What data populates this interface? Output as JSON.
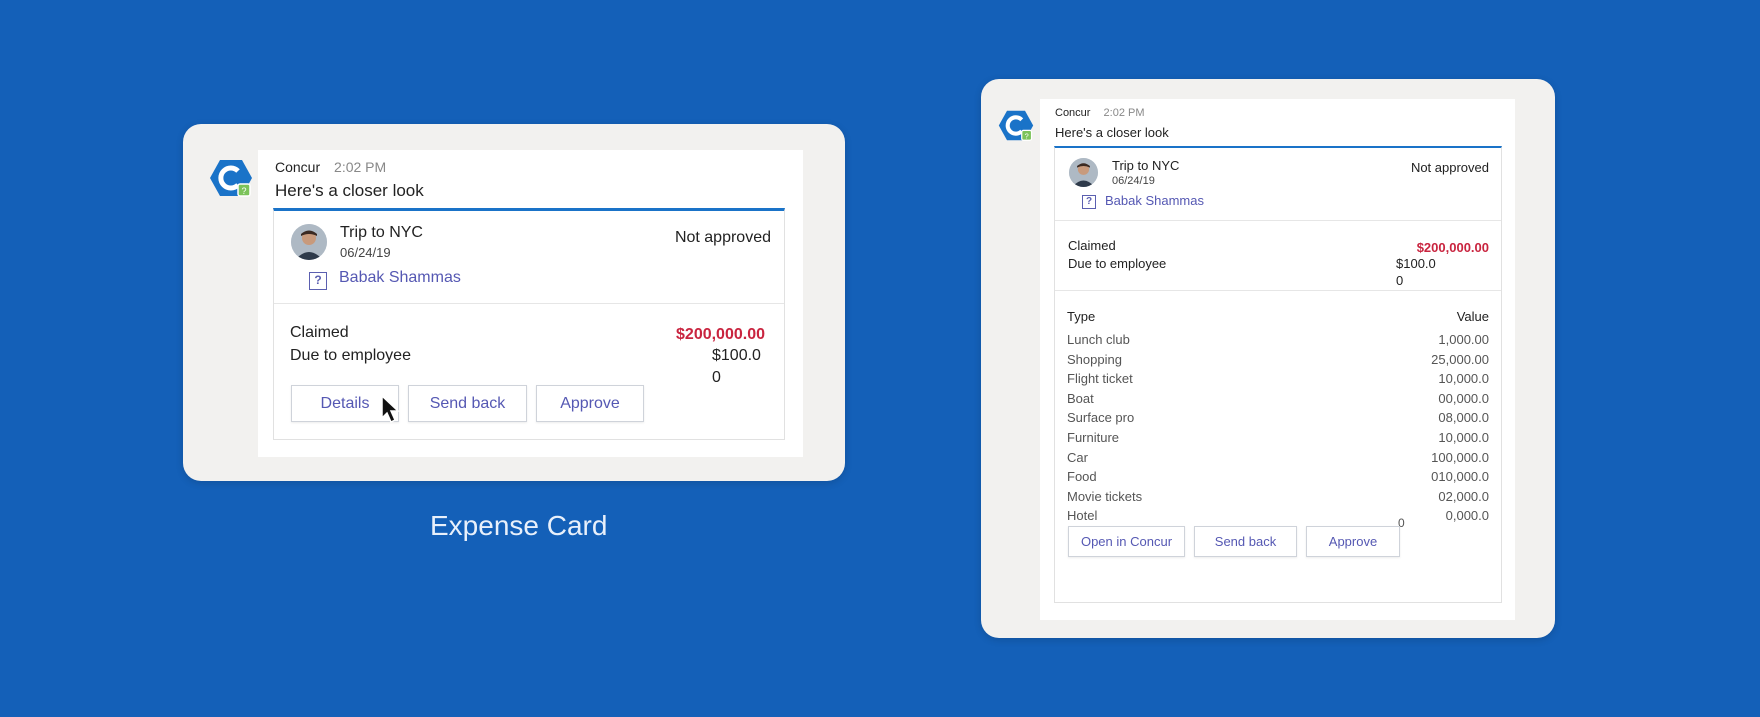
{
  "caption": "Expense Card",
  "left_card": {
    "sender": "Concur",
    "time": "2:02 PM",
    "subtitle": "Here's a closer look",
    "trip_title": "Trip to NYC",
    "trip_date": "06/24/19",
    "status": "Not approved",
    "employee": "Babak Shammas",
    "claimed_label": "Claimed",
    "claimed_value": "$200,000.00",
    "due_label": "Due to employee",
    "due_value_line1": "$100.0",
    "due_value_line2": "0",
    "buttons": [
      "Details",
      "Send back",
      "Approve"
    ]
  },
  "right_card": {
    "sender": "Concur",
    "time": "2:02 PM",
    "subtitle": "Here's a closer look",
    "trip_title": "Trip to NYC",
    "trip_date": "06/24/19",
    "status": "Not approved",
    "employee": "Babak Shammas",
    "claimed_label": "Claimed",
    "claimed_value": "$200,000.00",
    "due_label": "Due to employee",
    "due_value_line1": "$100.0",
    "due_value_line2": "0",
    "table_header_type": "Type",
    "table_header_value": "Value",
    "rows": [
      {
        "type": "Lunch club",
        "value": "1,000.00"
      },
      {
        "type": "Shopping",
        "value": "25,000.00"
      },
      {
        "type": "Flight ticket",
        "value": "10,000.0"
      },
      {
        "type": "Boat",
        "value": "00,000.0"
      },
      {
        "type": "Surface pro",
        "value": "08,000.0"
      },
      {
        "type": "Furniture",
        "value": "10,000.0"
      },
      {
        "type": "Car",
        "value": "100,000.0"
      },
      {
        "type": "Food",
        "value": "010,000.0"
      },
      {
        "type": "Movie tickets",
        "value": "02,000.0"
      },
      {
        "type": "Hotel",
        "value": "0,000.0"
      }
    ],
    "trailing_value": "0",
    "buttons": [
      "Open in Concur",
      "Send back",
      "Approve"
    ]
  },
  "colors": {
    "background": "#1460b8",
    "accent": "#1a73c8",
    "link": "#5558b3",
    "claimed": "#c9243f"
  }
}
